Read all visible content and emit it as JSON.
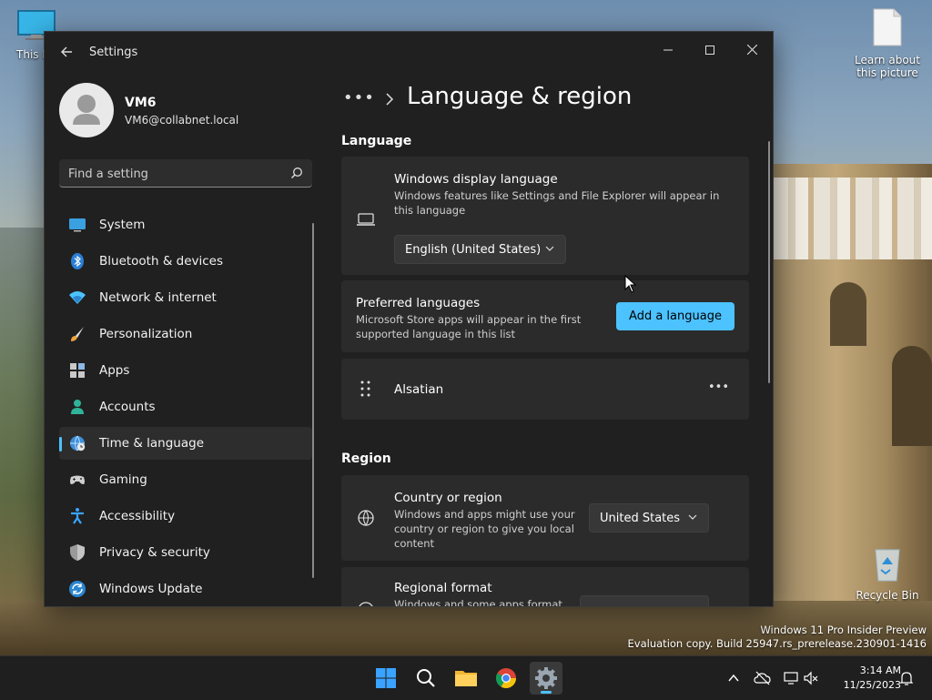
{
  "desktop": {
    "icons": [
      {
        "label": "This PC"
      },
      {
        "label": "Learn about this picture"
      },
      {
        "label": "Recycle Bin"
      }
    ],
    "watermark": {
      "line1": "Windows 11 Pro Insider Preview",
      "line2": "Evaluation copy. Build 25947.rs_prerelease.230901-1416"
    }
  },
  "window": {
    "title": "Settings",
    "controls": {
      "minimize": "—",
      "maximize": "☐",
      "close": "✕"
    }
  },
  "profile": {
    "name": "VM6",
    "email": "VM6@collabnet.local"
  },
  "search": {
    "placeholder": "Find a setting"
  },
  "sidebar": {
    "items": [
      {
        "label": "System",
        "icon": "monitor-icon"
      },
      {
        "label": "Bluetooth & devices",
        "icon": "bluetooth-icon"
      },
      {
        "label": "Network & internet",
        "icon": "wifi-icon"
      },
      {
        "label": "Personalization",
        "icon": "brush-icon"
      },
      {
        "label": "Apps",
        "icon": "apps-icon"
      },
      {
        "label": "Accounts",
        "icon": "person-icon"
      },
      {
        "label": "Time & language",
        "icon": "globe-clock-icon",
        "selected": true
      },
      {
        "label": "Gaming",
        "icon": "gamepad-icon"
      },
      {
        "label": "Accessibility",
        "icon": "accessibility-icon"
      },
      {
        "label": "Privacy & security",
        "icon": "shield-icon"
      },
      {
        "label": "Windows Update",
        "icon": "update-icon"
      }
    ]
  },
  "main": {
    "breadcrumb_more": "•••",
    "page_title": "Language & region",
    "language_section": "Language",
    "display_language": {
      "title": "Windows display language",
      "desc": "Windows features like Settings and File Explorer will appear in this language",
      "selected": "English (United States)"
    },
    "preferred_languages": {
      "title": "Preferred languages",
      "desc": "Microsoft Store apps will appear in the first supported language in this list",
      "button": "Add a language"
    },
    "language_item": {
      "name": "Alsatian",
      "more": "•••"
    },
    "region_section": "Region",
    "country": {
      "title": "Country or region",
      "desc": "Windows and apps might use your country or region to give you local content",
      "selected": "United States"
    },
    "regional_format": {
      "title": "Regional format",
      "desc": "Windows and some apps format"
    }
  },
  "taskbar": {
    "time": "3:14 AM",
    "date": "11/25/2023"
  },
  "colors": {
    "accent": "#4cc2ff",
    "window_bg": "#202020",
    "card_bg": "#2b2b2b"
  }
}
